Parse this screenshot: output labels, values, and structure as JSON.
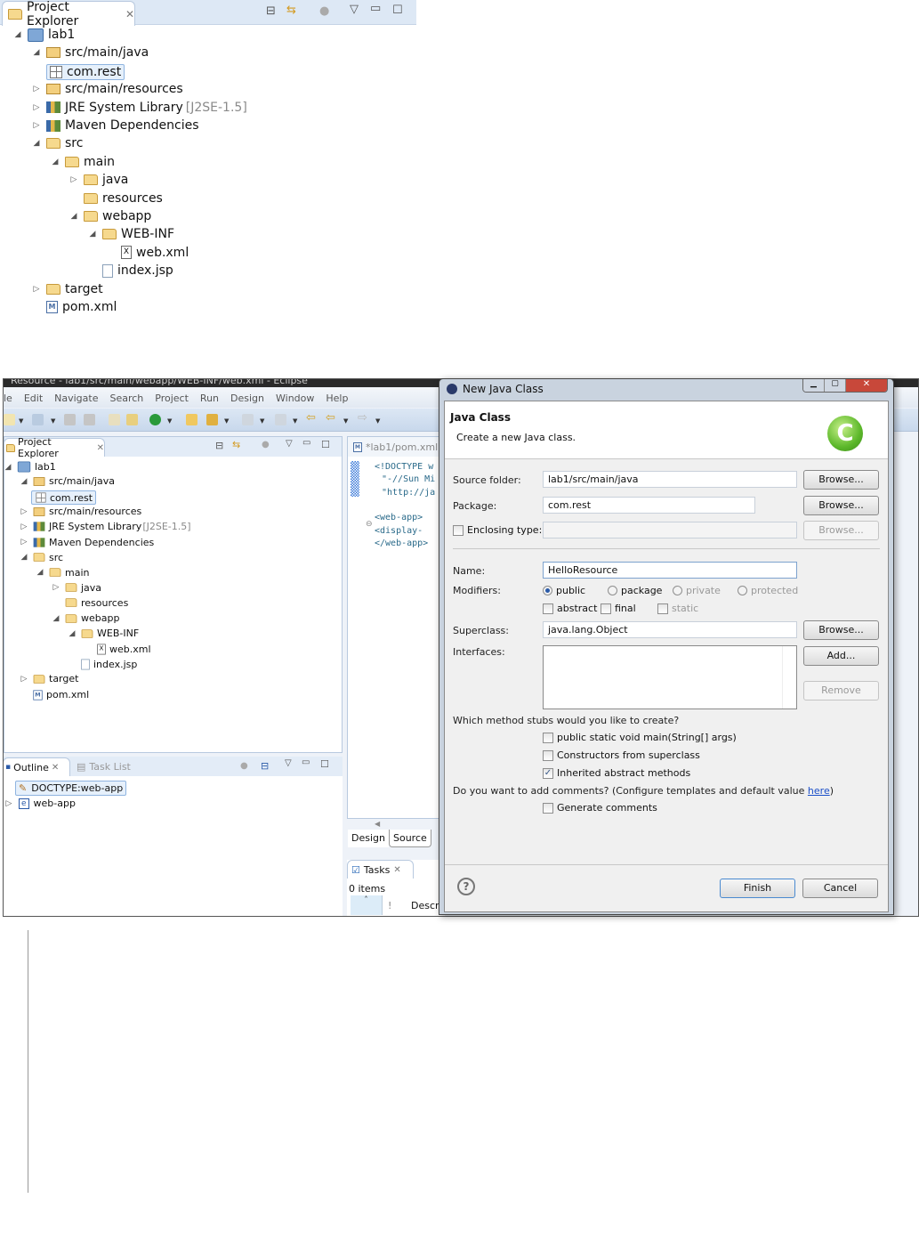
{
  "top_panel": {
    "tab_label": "Project Explorer",
    "tree": [
      {
        "label": "lab1",
        "level": 0,
        "toggle": "expanded",
        "icon": "project-icon"
      },
      {
        "label": "src/main/java",
        "level": 1,
        "toggle": "expanded",
        "icon": "source-folder-icon"
      },
      {
        "label": "com.rest",
        "level": 2,
        "toggle": "none",
        "icon": "package-icon",
        "selected": true
      },
      {
        "label": "src/main/resources",
        "level": 1,
        "toggle": "collapsed",
        "icon": "source-folder-icon"
      },
      {
        "label": "JRE System Library",
        "decoration": "[J2SE-1.5]",
        "level": 1,
        "toggle": "collapsed",
        "icon": "library-icon"
      },
      {
        "label": "Maven Dependencies",
        "level": 1,
        "toggle": "collapsed",
        "icon": "library-icon"
      },
      {
        "label": "src",
        "level": 1,
        "toggle": "expanded",
        "icon": "folder-icon"
      },
      {
        "label": "main",
        "level": 2,
        "toggle": "expanded",
        "icon": "folder-icon"
      },
      {
        "label": "java",
        "level": 3,
        "toggle": "collapsed",
        "icon": "folder-icon"
      },
      {
        "label": "resources",
        "level": 3,
        "toggle": "none",
        "icon": "folder-icon"
      },
      {
        "label": "webapp",
        "level": 3,
        "toggle": "expanded",
        "icon": "folder-icon"
      },
      {
        "label": "WEB-INF",
        "level": 4,
        "toggle": "expanded",
        "icon": "folder-icon"
      },
      {
        "label": "web.xml",
        "level": 5,
        "toggle": "none",
        "icon": "xml-file-icon"
      },
      {
        "label": "index.jsp",
        "level": 4,
        "toggle": "none",
        "icon": "file-icon"
      },
      {
        "label": "target",
        "level": 1,
        "toggle": "collapsed",
        "icon": "folder-icon"
      },
      {
        "label": "pom.xml",
        "level": 1,
        "toggle": "none",
        "icon": "maven-file-icon"
      }
    ]
  },
  "window": {
    "title": "Resource - lab1/src/main/webapp/WEB-INF/web.xml - Eclipse",
    "menu": [
      "le",
      "Edit",
      "Navigate",
      "Search",
      "Project",
      "Run",
      "Design",
      "Window",
      "Help"
    ],
    "editor": {
      "tab_label": "*lab1/pom.xml",
      "code_lines": [
        "<!DOCTYPE w",
        "\"-//Sun Mi",
        "\"http://ja",
        "",
        "<web-app>",
        "  <display-",
        "</web-app>"
      ],
      "bottom_tabs": [
        "Design",
        "Source"
      ]
    },
    "outline": {
      "tabs": [
        "Outline",
        "Task List"
      ],
      "items": [
        "DOCTYPE:web-app",
        "web-app"
      ]
    },
    "tasks": {
      "tab_label": "Tasks",
      "count": "0 items",
      "columns": [
        "!",
        "Descr"
      ]
    }
  },
  "dialog": {
    "title": "New Java Class",
    "heading": "Java Class",
    "subheading": "Create a new Java class.",
    "source_folder": {
      "label": "Source folder:",
      "value": "lab1/src/main/java",
      "button": "Browse..."
    },
    "package": {
      "label": "Package:",
      "value": "com.rest",
      "button": "Browse..."
    },
    "enclosing": {
      "label": "Enclosing type:",
      "value": "",
      "button": "Browse...",
      "checked": false
    },
    "name": {
      "label": "Name:",
      "value": "HelloResource"
    },
    "modifiers": {
      "label": "Modifiers:",
      "access": [
        {
          "label": "public",
          "selected": true,
          "enabled": true
        },
        {
          "label": "package",
          "selected": false,
          "enabled": true
        },
        {
          "label": "private",
          "selected": false,
          "enabled": false
        },
        {
          "label": "protected",
          "selected": false,
          "enabled": false
        }
      ],
      "flags": [
        {
          "label": "abstract",
          "checked": false,
          "enabled": true
        },
        {
          "label": "final",
          "checked": false,
          "enabled": true
        },
        {
          "label": "static",
          "checked": false,
          "enabled": false
        }
      ]
    },
    "superclass": {
      "label": "Superclass:",
      "value": "java.lang.Object",
      "button": "Browse..."
    },
    "interfaces": {
      "label": "Interfaces:",
      "add_button": "Add...",
      "remove_button": "Remove"
    },
    "stubs": {
      "question": "Which method stubs would you like to create?",
      "options": [
        {
          "label": "public static void main(String[] args)",
          "checked": false
        },
        {
          "label": "Constructors from superclass",
          "checked": false
        },
        {
          "label": "Inherited abstract methods",
          "checked": true
        }
      ]
    },
    "comments": {
      "question": "Do you want to add comments? (Configure templates and default value ",
      "link": "here",
      "close": ")",
      "option": "Generate comments",
      "checked": false
    },
    "finish_button": "Finish",
    "cancel_button": "Cancel"
  }
}
